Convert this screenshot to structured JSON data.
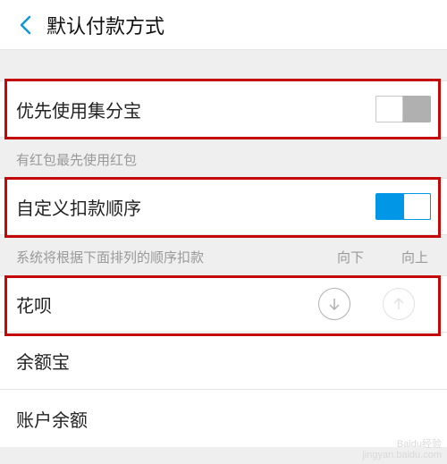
{
  "header": {
    "title": "默认付款方式"
  },
  "rows": {
    "jifenbao": {
      "label": "优先使用集分宝"
    },
    "custom_order": {
      "label": "自定义扣款顺序"
    }
  },
  "hints": {
    "hongbao": "有红包最先使用红包",
    "order_desc": "系统将根据下面排列的顺序扣款",
    "down": "向下",
    "up": "向上"
  },
  "payment_methods": [
    {
      "label": "花呗"
    },
    {
      "label": "余额宝"
    },
    {
      "label": "账户余额"
    }
  ],
  "watermark": {
    "brand": "Baidu经验",
    "url": "jingyan.baidu.com"
  }
}
